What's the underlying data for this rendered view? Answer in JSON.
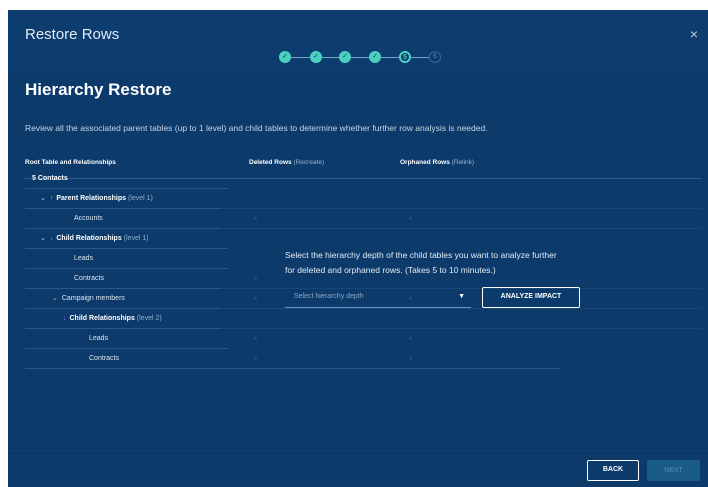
{
  "dialog": {
    "title": "Restore Rows",
    "close_icon": "×"
  },
  "stepper": {
    "steps": [
      {
        "state": "done",
        "label": "✓"
      },
      {
        "state": "done",
        "label": "✓"
      },
      {
        "state": "done",
        "label": "✓"
      },
      {
        "state": "done",
        "label": "✓"
      },
      {
        "state": "current",
        "label": "5"
      },
      {
        "state": "future",
        "label": "6"
      }
    ]
  },
  "page": {
    "title": "Hierarchy Restore",
    "description": "Review all the associated parent tables (up to 1 level) and child tables to determine whether further row analysis is needed."
  },
  "table": {
    "col1": "Root Table and Relationships",
    "col2_bold": "Deleted Rows",
    "col2_sub": "(Recreate)",
    "col3_bold": "Orphaned Rows",
    "col3_sub": "(Relink)",
    "rows": [
      {
        "label": "5 Contacts",
        "level": ""
      },
      {
        "label": "Parent Relationships",
        "level": "(level 1)"
      },
      {
        "label": "Accounts",
        "level": ""
      },
      {
        "label": "Child Relationships",
        "level": "(level 1)"
      },
      {
        "label": "Leads",
        "level": ""
      },
      {
        "label": "Contracts",
        "level": ""
      },
      {
        "label": "Campaign members",
        "level": ""
      },
      {
        "label": "Child Relationships",
        "level": "(level 2)"
      },
      {
        "label": "Leads",
        "level": ""
      },
      {
        "label": "Contracts",
        "level": ""
      }
    ]
  },
  "analysis": {
    "prompt_line1": "Select the hierarchy depth of the child tables you want to analyze further",
    "prompt_line2": "for deleted and orphaned rows. (Takes 5 to 10 minutes.)",
    "select_placeholder": "Select hierarchy depth",
    "analyze_button": "ANALYZE IMPACT"
  },
  "footer": {
    "back": "BACK",
    "next": "NEXT"
  },
  "colors": {
    "background": "#0c3a6b",
    "accent": "#4ad0bf",
    "child_arrow": "#8f6cf0"
  }
}
